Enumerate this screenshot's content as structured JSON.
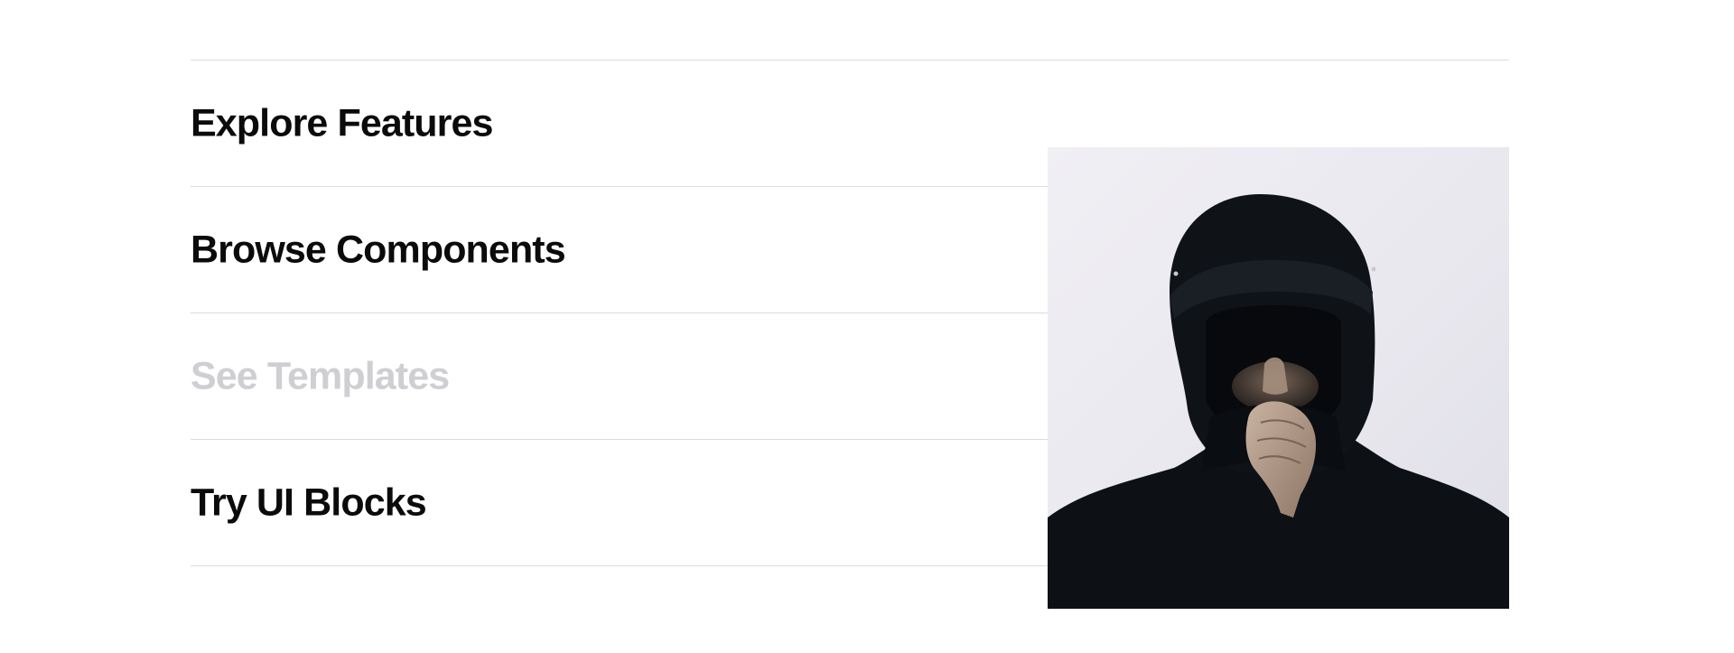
{
  "menu": {
    "items": [
      {
        "label": "Explore Features",
        "state": "default"
      },
      {
        "label": "Browse Components",
        "state": "default"
      },
      {
        "label": "See Templates",
        "state": "muted"
      },
      {
        "label": "Try UI Blocks",
        "state": "default"
      }
    ]
  },
  "preview": {
    "subject": "person in black hood covering face with hand"
  },
  "colors": {
    "text": "#0b0b0c",
    "muted_text": "#cfcfd3",
    "divider": "#dcdcde",
    "photo_background": "#eeedf2",
    "hood": "#0d1116"
  }
}
